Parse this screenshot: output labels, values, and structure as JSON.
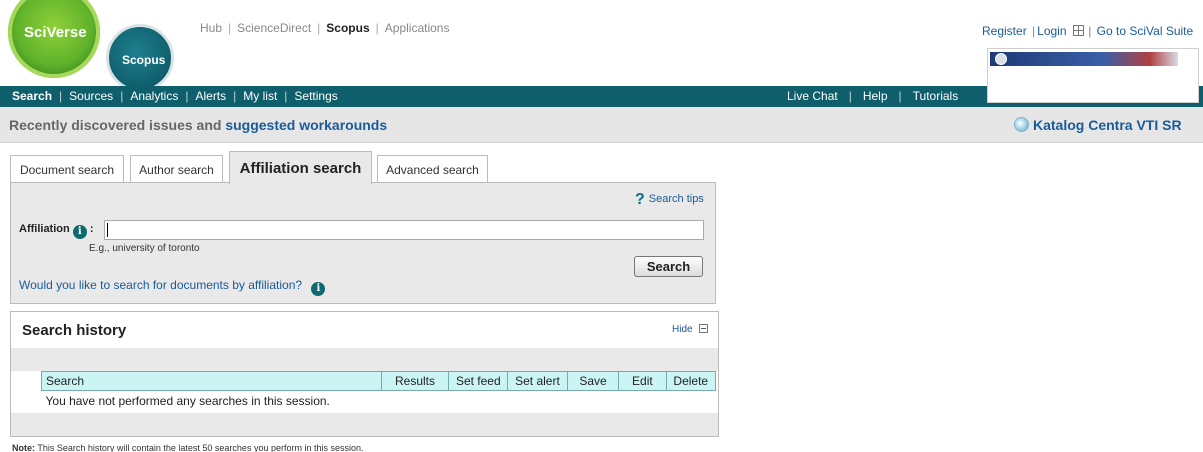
{
  "logos": {
    "sciverse": "SciVerse",
    "scopus": "Scopus"
  },
  "top_links": [
    "Hub",
    "ScienceDirect",
    "Scopus",
    "Applications"
  ],
  "user_links": {
    "register": "Register",
    "login": "Login",
    "scival": "Go to SciVal Suite"
  },
  "nav": {
    "left": [
      "Search",
      "Sources",
      "Analytics",
      "Alerts",
      "My list",
      "Settings"
    ],
    "right": [
      "Live Chat",
      "Help",
      "Tutorials"
    ]
  },
  "notice": {
    "prefix": "Recently discovered issues and ",
    "link": "suggested workarounds"
  },
  "institution": {
    "name": "Katalog Centra VTI SR"
  },
  "tabs": [
    "Document search",
    "Author search",
    "Affiliation search",
    "Advanced search"
  ],
  "search": {
    "tips": "Search tips",
    "label": "Affiliation",
    "input_value": "",
    "example": "E.g., university of toronto",
    "button": "Search",
    "doc_link": "Would you like to search for documents by affiliation?"
  },
  "history": {
    "title": "Search history",
    "hide": "Hide",
    "columns": [
      "Search",
      "Results",
      "Set feed",
      "Set alert",
      "Save",
      "Edit",
      "Delete"
    ],
    "empty_message": "You have not performed any searches in this session."
  },
  "note": {
    "label": "Note:",
    "text": " This Search history will contain the latest 50 searches you perform in this session."
  },
  "colors": {
    "nav_bg": "#0e5f6b",
    "link": "#1a5b9a",
    "table_header": "#cbf5f5",
    "panel_bg": "#e9e9e9"
  },
  "icons": [
    "grid-icon",
    "info-icon",
    "help-icon",
    "minus-icon",
    "katalog-icon"
  ]
}
